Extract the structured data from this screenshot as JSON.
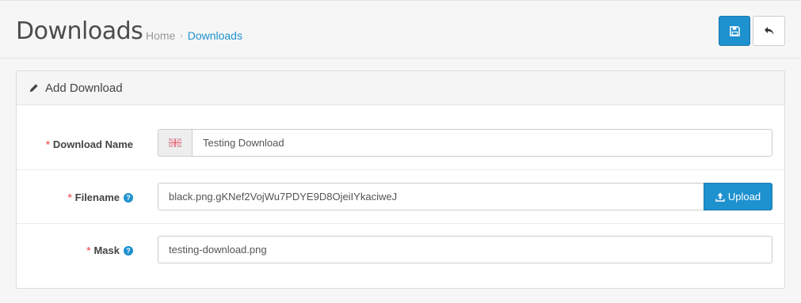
{
  "header": {
    "title": "Downloads",
    "breadcrumb": [
      {
        "label": "Home"
      },
      {
        "label": "Downloads"
      }
    ],
    "breadcrumb_separator": "›"
  },
  "panel": {
    "title": "Add Download"
  },
  "form": {
    "download_name": {
      "label": "Download Name",
      "required_marker": "*",
      "value": "Testing Download",
      "flag_icon": "uk-flag-icon"
    },
    "filename": {
      "label": "Filename",
      "required_marker": "*",
      "help": "?",
      "value": "black.png.gKNef2VojWu7PDYE9D8OjeiIYkaciweJ",
      "upload_label": "Upload"
    },
    "mask": {
      "label": "Mask",
      "required_marker": "*",
      "help": "?",
      "value": "testing-download.png"
    }
  },
  "colors": {
    "primary": "#1e91cf",
    "required": "#f56b6b",
    "link": "#1e91cf"
  },
  "icons": {
    "save": "floppy-disk-icon",
    "back": "reply-icon",
    "heading": "pencil-icon",
    "upload": "upload-icon"
  }
}
